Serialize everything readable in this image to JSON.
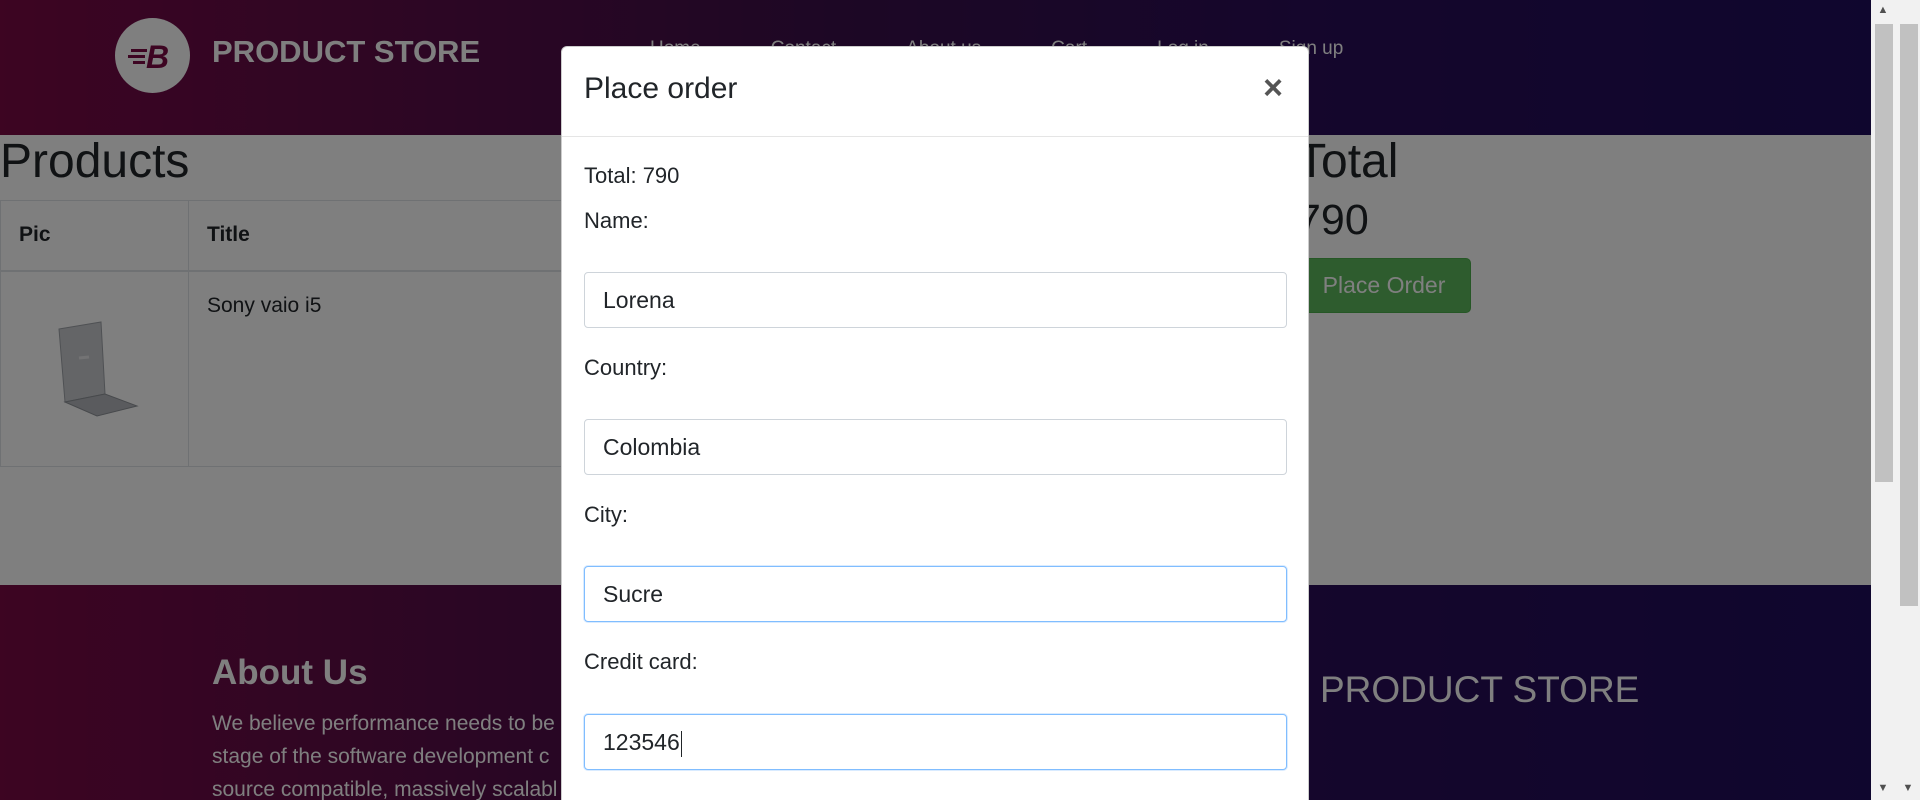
{
  "navbar": {
    "brand": "PRODUCT STORE",
    "logo_icon": "blazedemo-logo-icon",
    "links": [
      "Home",
      "Contact",
      "About us",
      "Cart",
      "Log in",
      "Sign up"
    ]
  },
  "cart": {
    "products_title": "Products",
    "columns": [
      "Pic",
      "Title"
    ],
    "rows": [
      {
        "pic": "laptop-image",
        "title": "Sony vaio i5"
      }
    ],
    "total_title": "Total",
    "total_amount": "790",
    "place_order_label": "Place Order"
  },
  "footer": {
    "about_title": "About Us",
    "about_lines": [
      "We believe performance needs to be",
      "stage of the software development c",
      "source compatible, massively scalabl"
    ],
    "brand": "PRODUCT STORE"
  },
  "modal": {
    "title": "Place order",
    "close_symbol": "×",
    "total_text": "Total: 790",
    "fields": [
      {
        "label": "Name:",
        "value": "Lorena"
      },
      {
        "label": "Country:",
        "value": "Colombia"
      },
      {
        "label": "City:",
        "value": "Sucre"
      },
      {
        "label": "Credit card:",
        "value": "123546"
      }
    ]
  },
  "colors": {
    "accent_green": "#5cb85c",
    "header_gradient_start": "#7a0a45",
    "header_gradient_end": "#1f0c5c"
  }
}
